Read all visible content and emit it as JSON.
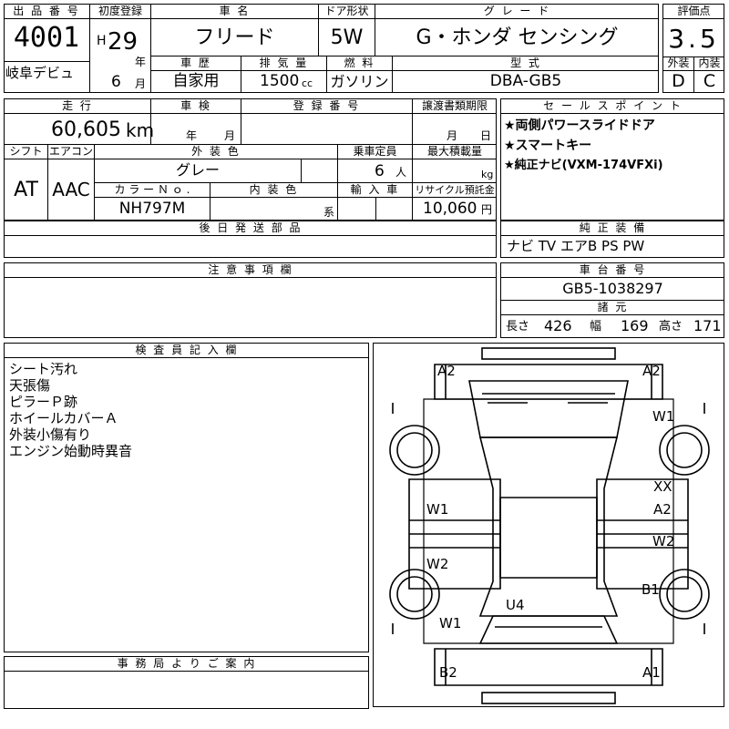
{
  "header": {
    "lot_no_label": "出 品 番 号",
    "lot_no": "4001",
    "venue": "岐阜デビュ",
    "first_reg_label": "初度登録",
    "era": "H",
    "year": "29",
    "year_unit": "年",
    "month": "6",
    "month_unit": "月",
    "car_name_label": "車 名",
    "car_name": "フリード",
    "door_label": "ドア形状",
    "door": "5W",
    "grade_label": "グ レ ー ド",
    "grade": "G・ホンダ センシング",
    "score_label": "評価点",
    "score": "3.5",
    "history_label": "車 歴",
    "history": "自家用",
    "displacement_label": "排 気 量",
    "displacement": "1500",
    "displacement_unit": "cc",
    "fuel_label": "燃 料",
    "fuel": "ガソリン",
    "model_label": "型 式",
    "model": "DBA-GB5",
    "exterior_grade_label": "外装",
    "exterior_grade": "D",
    "interior_grade_label": "内装",
    "interior_grade": "C"
  },
  "row2": {
    "mileage_label": "走 行",
    "mileage": "60,605",
    "mileage_unit": "km",
    "inspection_label": "車 検",
    "inspection_year_unit": "年",
    "inspection_month_unit": "月",
    "reg_no_label": "登 録 番 号",
    "transfer_label": "譲渡書類期限",
    "transfer_month_unit": "月",
    "transfer_day_unit": "日",
    "shift_label": "シフト",
    "shift": "AT",
    "ac_label": "エアコン",
    "ac": "AAC",
    "color_label": "外 装 色",
    "color": "グレー",
    "capacity_label": "乗車定員",
    "capacity": "6",
    "capacity_unit": "人",
    "load_label": "最大積載量",
    "load_unit": "kg",
    "color_no_label": "カ ラ ー Ｎ ｏ .",
    "color_no": "NH797M",
    "interior_color_label": "内 装 色",
    "interior_color_unit": "系",
    "import_label": "輸 入 車",
    "recycle_label": "リサイクル預託金",
    "recycle": "10,060",
    "recycle_unit": "円"
  },
  "sales_points": {
    "label": "セ ー ル ス ポ イ ン ト",
    "items": [
      "★両側パワースライドドア",
      "★スマートキー",
      "★純正ナビ(VXM-174VFXi)"
    ]
  },
  "delivery": {
    "label": "後 日 発 送 部 品"
  },
  "equipment": {
    "label": "純 正 装 備",
    "value": "ナビ TV エアB PS PW"
  },
  "cautions": {
    "label": "注 意 事 項 欄"
  },
  "chassis": {
    "label": "車 台 番 号",
    "value": "GB5-1038297"
  },
  "dimensions": {
    "label": "諸 元",
    "length_label": "長さ",
    "length": "426",
    "width_label": "幅",
    "width": "169",
    "height_label": "高さ",
    "height": "171"
  },
  "inspector": {
    "label": "検 査 員 記 入 欄",
    "notes": [
      "シート汚れ",
      "天張傷",
      "ピラーＰ跡",
      "ホイールカバーＡ",
      "外装小傷有り",
      "エンジン始動時異音"
    ]
  },
  "office": {
    "label": "事 務 局 よ り ご 案 内"
  },
  "damage_marks": {
    "front_left": "A2",
    "front_right": "A2",
    "right_front_wheel": "W1",
    "xx": "XX",
    "right_front_door": "A2",
    "right_rear_door": "W2",
    "right_rear": "B1",
    "left_front_door": "W1",
    "left_rear_door": "W2",
    "left_rear_wheel": "W1",
    "roof": "U4",
    "rear_left": "B2",
    "rear_right": "A1"
  }
}
